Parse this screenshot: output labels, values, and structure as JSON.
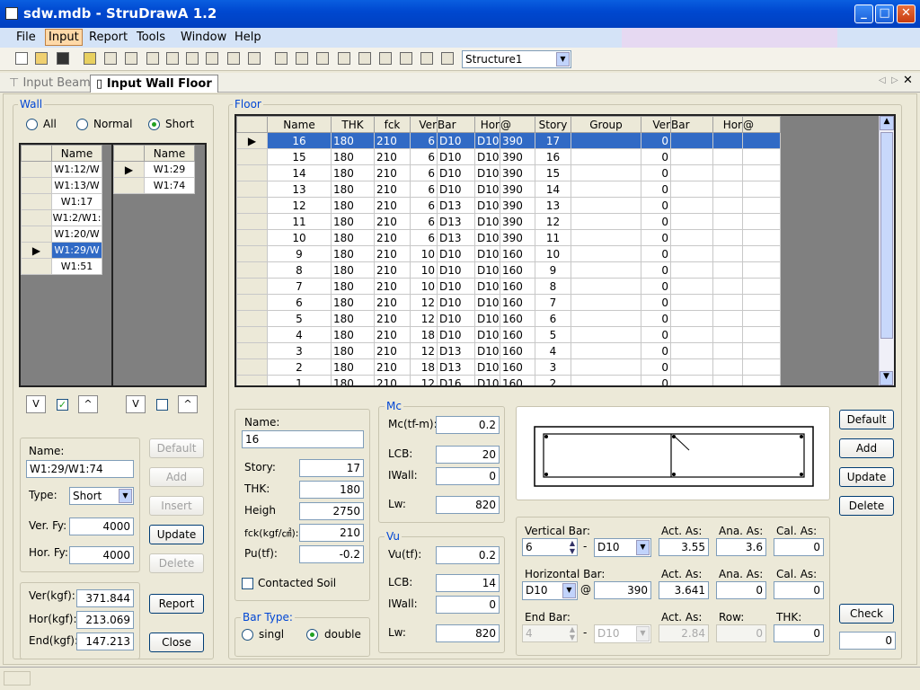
{
  "window": {
    "title": "sdw.mdb - StruDrawA 1.2"
  },
  "menu": [
    "File",
    "Input",
    "Report",
    "Tools",
    "Window",
    "Help"
  ],
  "toolbar": {
    "structure": "Structure1"
  },
  "tabs": [
    "Input Beam",
    "Input Wall Floor"
  ],
  "wall": {
    "label": "Wall",
    "filters": [
      "All",
      "Normal",
      "Short"
    ],
    "selected_filter": "Short",
    "list1_header": "Name",
    "list1": [
      "W1:12/W",
      "W1:13/W",
      "W1:17",
      "W1:2/W1:",
      "W1:20/W",
      "W1:29/W",
      "W1:51"
    ],
    "list1_selected": 5,
    "list2_header": "Name",
    "list2": [
      "W1:29",
      "W1:74"
    ],
    "form": {
      "name_label": "Name:",
      "name": "W1:29/W1:74",
      "type_label": "Type:",
      "type": "Short",
      "verfy_label": "Ver. Fy:",
      "verfy": "4000",
      "horfy_label": "Hor. Fy:",
      "horfy": "4000"
    },
    "buttons": [
      "Default",
      "Add",
      "Insert",
      "Update",
      "Delete"
    ],
    "results": {
      "ver_label": "Ver(kgf):",
      "ver": "371.844",
      "hor_label": "Hor(kgf):",
      "hor": "213.069",
      "end_label": "End(kgf):",
      "end": "147.213"
    },
    "report_btn": "Report",
    "close_btn": "Close"
  },
  "floor": {
    "label": "Floor",
    "headers": [
      "Name",
      "THK",
      "fck",
      "Ver",
      "Bar",
      "Hor",
      "@",
      "Story",
      "Group",
      "Ver",
      "Bar",
      "Hor",
      "@"
    ],
    "rows": [
      [
        "16",
        "180",
        "210",
        "6",
        "D10",
        "D10",
        "390",
        "17",
        "",
        "0",
        "",
        "0"
      ],
      [
        "15",
        "180",
        "210",
        "6",
        "D10",
        "D10",
        "390",
        "16",
        "",
        "0",
        "",
        "0"
      ],
      [
        "14",
        "180",
        "210",
        "6",
        "D10",
        "D10",
        "390",
        "15",
        "",
        "0",
        "",
        "0"
      ],
      [
        "13",
        "180",
        "210",
        "6",
        "D10",
        "D10",
        "390",
        "14",
        "",
        "0",
        "",
        "0"
      ],
      [
        "12",
        "180",
        "210",
        "6",
        "D13",
        "D10",
        "390",
        "13",
        "",
        "0",
        "",
        "0"
      ],
      [
        "11",
        "180",
        "210",
        "6",
        "D13",
        "D10",
        "390",
        "12",
        "",
        "0",
        "",
        "0"
      ],
      [
        "10",
        "180",
        "210",
        "6",
        "D13",
        "D10",
        "390",
        "11",
        "",
        "0",
        "",
        "0"
      ],
      [
        "9",
        "180",
        "210",
        "10",
        "D10",
        "D10",
        "160",
        "10",
        "",
        "0",
        "",
        "0"
      ],
      [
        "8",
        "180",
        "210",
        "10",
        "D10",
        "D10",
        "160",
        "9",
        "",
        "0",
        "",
        "0"
      ],
      [
        "7",
        "180",
        "210",
        "10",
        "D10",
        "D10",
        "160",
        "8",
        "",
        "0",
        "",
        "0"
      ],
      [
        "6",
        "180",
        "210",
        "12",
        "D10",
        "D10",
        "160",
        "7",
        "",
        "0",
        "",
        "0"
      ],
      [
        "5",
        "180",
        "210",
        "12",
        "D10",
        "D10",
        "160",
        "6",
        "",
        "0",
        "",
        "0"
      ],
      [
        "4",
        "180",
        "210",
        "18",
        "D10",
        "D10",
        "160",
        "5",
        "",
        "0",
        "",
        "0"
      ],
      [
        "3",
        "180",
        "210",
        "12",
        "D13",
        "D10",
        "160",
        "4",
        "",
        "0",
        "",
        "0"
      ],
      [
        "2",
        "180",
        "210",
        "18",
        "D13",
        "D10",
        "160",
        "3",
        "",
        "0",
        "",
        "0"
      ],
      [
        "1",
        "180",
        "210",
        "12",
        "D16",
        "D10",
        "160",
        "2",
        "",
        "0",
        "",
        "0"
      ]
    ],
    "selected_row": 0
  },
  "props": {
    "name_label": "Name:",
    "name": "16",
    "story_label": "Story:",
    "story": "17",
    "thk_label": "THK:",
    "thk": "180",
    "height_label": "Heigh",
    "height": "2750",
    "fck_label": "fck(kgf/㎠):",
    "fck": "210",
    "pu_label": "Pu(tf):",
    "pu": "-0.2",
    "soil_label": "Contacted Soil",
    "bartype_label": "Bar Type:",
    "bartype_opts": [
      "singl",
      "double"
    ],
    "bartype_selected": "double"
  },
  "mc": {
    "label": "Mc",
    "mc_label": "Mc(tf-m):",
    "mc": "0.2",
    "lcb_label": "LCB:",
    "lcb": "20",
    "iwall_label": "IWall:",
    "iwall": "0",
    "lw_label": "Lw:",
    "lw": "820"
  },
  "vu": {
    "label": "Vu",
    "vu_label": "Vu(tf):",
    "vu": "0.2",
    "lcb_label": "LCB:",
    "lcb": "14",
    "iwall_label": "IWall:",
    "iwall": "0",
    "lw_label": "Lw:",
    "lw": "820"
  },
  "bars": {
    "vert_label": "Vertical Bar:",
    "vert_n": "6",
    "vert_bar": "D10",
    "horz_label": "Horizontal Bar:",
    "horz_bar": "D10",
    "horz_at": "390",
    "end_label": "End Bar:",
    "end_n": "4",
    "end_bar": "D10",
    "act_label": "Act. As:",
    "ana_label": "Ana. As:",
    "cal_label": "Cal. As:",
    "row_label": "Row:",
    "thk_label": "THK:",
    "v_act": "3.55",
    "v_ana": "3.6",
    "v_cal": "0",
    "h_act": "3.641",
    "h_ana": "0",
    "h_cal": "0",
    "e_act": "2.84",
    "e_row": "0",
    "e_thk": "0"
  },
  "right_buttons": [
    "Default",
    "Add",
    "Update",
    "Delete"
  ],
  "check": {
    "label": "Check",
    "value": "0"
  }
}
